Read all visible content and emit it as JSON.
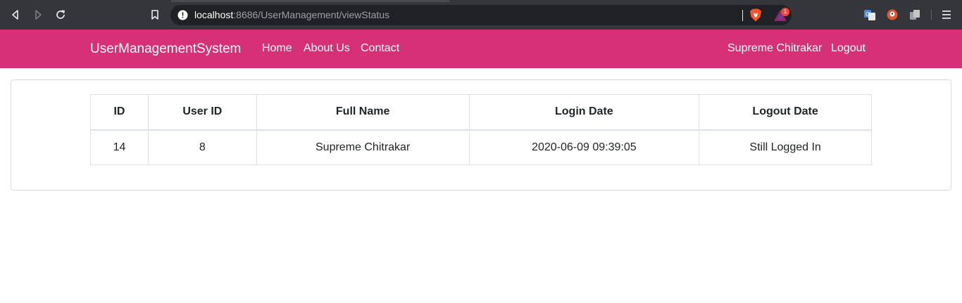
{
  "browser": {
    "url_host": "localhost",
    "url_rest": ":8686/UserManagement/viewStatus",
    "rewards_count": "1"
  },
  "navbar": {
    "brand": "UserManagementSystem",
    "links": [
      "Home",
      "About Us",
      "Contact"
    ],
    "user_name": "Supreme Chitrakar",
    "logout": "Logout",
    "color": "#d63077"
  },
  "table": {
    "headers": [
      "ID",
      "User ID",
      "Full Name",
      "Login Date",
      "Logout Date"
    ],
    "rows": [
      [
        "14",
        "8",
        "Supreme Chitrakar",
        "2020-06-09 09:39:05",
        "Still Logged In"
      ]
    ]
  }
}
